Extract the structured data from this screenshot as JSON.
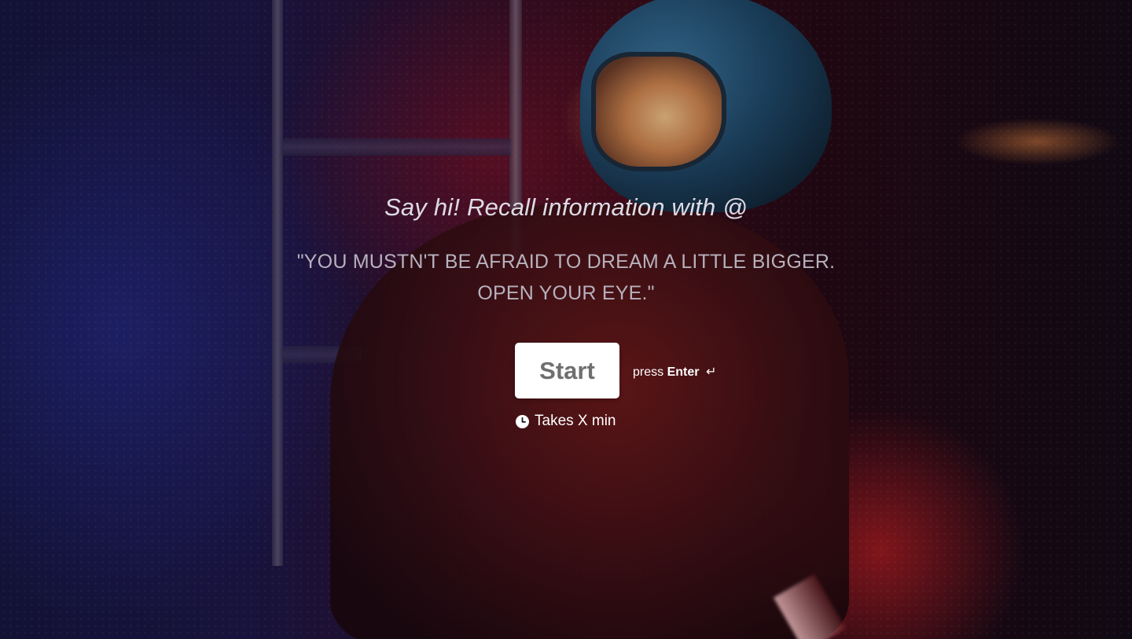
{
  "welcome": {
    "greeting": "Say hi! Recall information with @",
    "quote_line_1": "\"YOU MUSTN'T BE AFRAID TO DREAM A LITTLE BIGGER.",
    "quote_line_2": "OPEN YOUR EYE.\"",
    "start_label": "Start",
    "hint_prefix": "press",
    "hint_key": "Enter",
    "hint_icon_glyph": "↵",
    "duration_text": "Takes X min",
    "duration_icon": "clock-icon"
  },
  "colors": {
    "button_background": "#ffffff",
    "button_text": "#6f6f6f",
    "greeting_text": "#dedbe6",
    "quote_text": "#b7b1bd"
  }
}
